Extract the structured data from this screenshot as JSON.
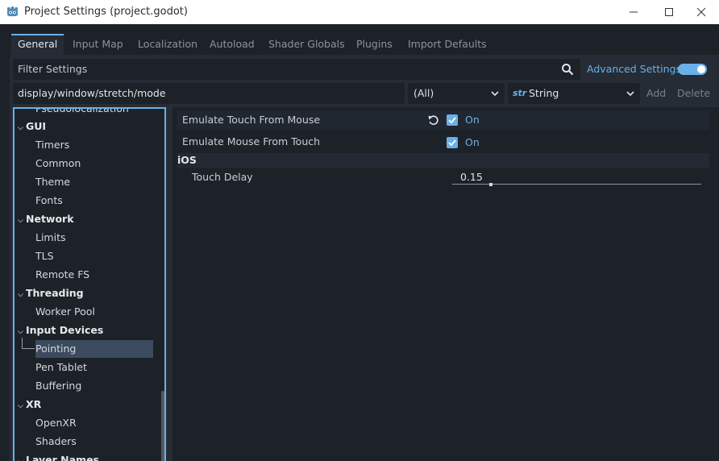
{
  "window": {
    "title": "Project Settings (project.godot)"
  },
  "tabs": [
    {
      "label": "General",
      "active": true
    },
    {
      "label": "Input Map"
    },
    {
      "label": "Localization"
    },
    {
      "label": "Autoload"
    },
    {
      "label": "Shader Globals"
    },
    {
      "label": "Plugins"
    },
    {
      "label": "Import Defaults"
    }
  ],
  "filter": {
    "placeholder": "Filter Settings",
    "advanced_label": "Advanced Settings",
    "advanced_enabled": true
  },
  "add_row": {
    "path": "display/window/stretch/mode",
    "feature": "(All)",
    "type_icon": "str",
    "type": "String",
    "add_label": "Add",
    "delete_label": "Delete"
  },
  "tree": {
    "items": [
      {
        "label": "Pseudolocalization",
        "level": 1
      },
      {
        "label": "GUI",
        "level": 0
      },
      {
        "label": "Timers",
        "level": 1
      },
      {
        "label": "Common",
        "level": 1
      },
      {
        "label": "Theme",
        "level": 1
      },
      {
        "label": "Fonts",
        "level": 1
      },
      {
        "label": "Network",
        "level": 0
      },
      {
        "label": "Limits",
        "level": 1
      },
      {
        "label": "TLS",
        "level": 1
      },
      {
        "label": "Remote FS",
        "level": 1
      },
      {
        "label": "Threading",
        "level": 0
      },
      {
        "label": "Worker Pool",
        "level": 1
      },
      {
        "label": "Input Devices",
        "level": 0
      },
      {
        "label": "Pointing",
        "level": 1,
        "selected": true
      },
      {
        "label": "Pen Tablet",
        "level": 1
      },
      {
        "label": "Buffering",
        "level": 1
      },
      {
        "label": "XR",
        "level": 0
      },
      {
        "label": "OpenXR",
        "level": 1
      },
      {
        "label": "Shaders",
        "level": 1
      },
      {
        "label": "Layer Names",
        "level": 0
      }
    ]
  },
  "inspector": {
    "emulate_touch": {
      "label": "Emulate Touch From Mouse",
      "value": "On"
    },
    "emulate_mouse": {
      "label": "Emulate Mouse From Touch",
      "value": "On"
    },
    "ios_section": "iOS",
    "touch_delay": {
      "label": "Touch Delay",
      "value": "0.15",
      "level": 0.15
    }
  },
  "colors": {
    "accent": "#6ab0e8",
    "background": "#1d2229",
    "panel": "#262c35"
  }
}
